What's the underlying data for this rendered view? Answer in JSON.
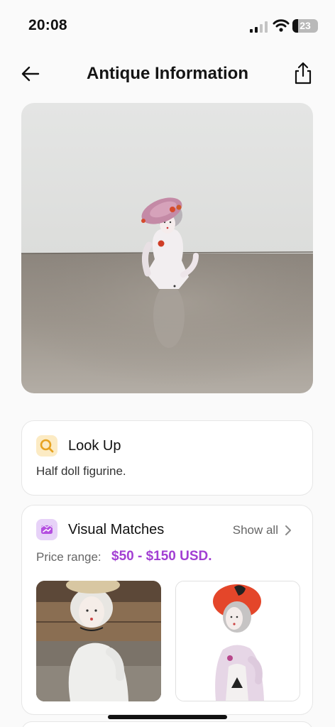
{
  "status_bar": {
    "time": "20:08",
    "battery_percent": "23",
    "battery_level": 0.23,
    "signal_bars": 2
  },
  "header": {
    "title": "Antique Information",
    "back_icon": "arrow-left-icon",
    "share_icon": "share-icon"
  },
  "lookup": {
    "icon": "search-icon",
    "title": "Look Up",
    "description": "Half doll figurine."
  },
  "visual_matches": {
    "icon": "matches-icon",
    "title": "Visual Matches",
    "show_all": "Show all",
    "price_label": "Price range:",
    "price_value": "$50 - $150 USD."
  },
  "colors": {
    "accent_purple": "#a23fd3",
    "lookup_icon_bg": "#fcebc4",
    "lookup_icon": "#e7a321",
    "matches_icon_bg": "#e7d2f8",
    "matches_icon": "#b44ee0"
  }
}
